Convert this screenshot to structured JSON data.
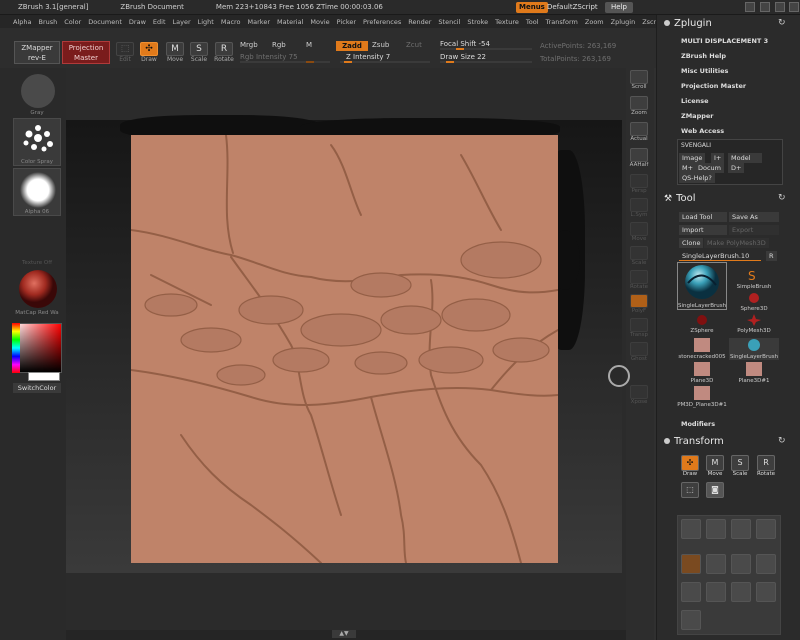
{
  "titlebar": {
    "app": "ZBrush  3.1[general]",
    "doc": "ZBrush Document",
    "mem": "Mem 223+10843 Free 1056 ZTime 00:00:03.06",
    "menus": "Menus",
    "script": "DefaultZScript",
    "help": "Help"
  },
  "menubar": [
    "Alpha",
    "Brush",
    "Color",
    "Document",
    "Draw",
    "Edit",
    "Layer",
    "Light",
    "Macro",
    "Marker",
    "Material",
    "Movie",
    "Picker",
    "Preferences",
    "Render",
    "Stencil",
    "Stroke",
    "Texture",
    "Tool",
    "Transform",
    "Zoom",
    "Zplugin",
    "Zscript"
  ],
  "shelf": {
    "zmapper_1": "ZMapper",
    "zmapper_2": "rev-E",
    "proj_1": "Projection",
    "proj_2": "Master",
    "edit": "Edit",
    "draw": "Draw",
    "move": "Move",
    "scale": "Scale",
    "rotate": "Rotate",
    "mrgb": "Mrgb",
    "rgb": "Rgb",
    "m": "M",
    "rgb_int": "Rgb Intensity 75",
    "zadd": "Zadd",
    "zsub": "Zsub",
    "zcut": "Zcut",
    "z_int": "Z Intensity 7",
    "focal": "Focal Shift -54",
    "draw_size": "Draw Size 22",
    "active_pts": "ActivePoints: 263,169",
    "total_pts": "TotalPoints: 263,169"
  },
  "left": {
    "gray_lbl": "Gray",
    "spray_lbl": "Color Spray",
    "alpha_lbl": "Alpha 06",
    "texture_lbl": "Texture Off",
    "matcap_lbl": "MatCap Red Wa",
    "switchcolor": "SwitchColor"
  },
  "rightstrip": [
    "Scroll",
    "Zoom",
    "Actual",
    "AAHalf",
    "Persp",
    "L.Sym",
    "Move",
    "Scale",
    "Rotate",
    "PolyF",
    "Transp",
    "Ghost",
    "Xpose"
  ],
  "zplugin": {
    "title": "Zplugin",
    "items": [
      "MULTI DISPLACEMENT 3",
      "ZBrush Help",
      "Misc Utilities",
      "Projection Master",
      "License",
      "ZMapper",
      "Web Access"
    ],
    "svengali": "SVENGALI",
    "image": "Image",
    "i_plus": "I+",
    "model": "Model",
    "m_plus": "M+",
    "docum": "Docum",
    "d_plus": "D+",
    "qs_help": "QS-Help?"
  },
  "tool": {
    "title": "Tool",
    "load": "Load Tool",
    "save": "Save As",
    "import": "Import",
    "export": "Export",
    "clone": "Clone",
    "make_poly": "Make PolyMesh3D",
    "current": "SingleLayerBrush.10",
    "r": "R",
    "cells": [
      "SingleLayerBrush",
      "SimpleBrush",
      "Sphere3D",
      "ZSphere",
      "PolyMesh3D",
      "stonecracked005",
      "SingleLayerBrush",
      "Plane3D",
      "Plane3D#1",
      "PM3D_Plane3D#1"
    ],
    "modifiers": "Modifiers"
  },
  "transform": {
    "title": "Transform",
    "draw": "Draw",
    "move": "Move",
    "scale": "Scale",
    "rotate": "Rotate"
  },
  "colors": {
    "accent": "#e07a1b",
    "texture": "#c0846a",
    "projection": "#7a1c1c"
  }
}
